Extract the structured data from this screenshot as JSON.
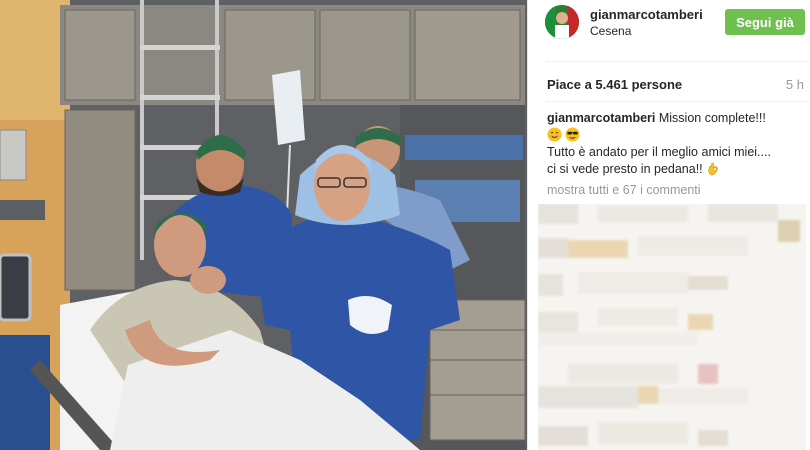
{
  "post": {
    "photo_icon": "post-photo",
    "colors": {
      "scrubs": "#2f55a6",
      "cap": "#2f6c4a",
      "follow": "#70c050"
    }
  },
  "header": {
    "username": "gianmarcotamberi",
    "location": "Cesena",
    "follow_label": "Segui già"
  },
  "stats": {
    "likes": "Piace a 5.461 persone",
    "time": "5 h"
  },
  "caption": {
    "username": "gianmarcotamberi",
    "line1": "Mission complete!!!",
    "line2": "Tutto è andato per il meglio amici miei....",
    "line3": "ci si vede presto in pedana!!"
  },
  "comments": {
    "view_all": "mostra tutti e 67 i commenti",
    "blurred": true
  }
}
